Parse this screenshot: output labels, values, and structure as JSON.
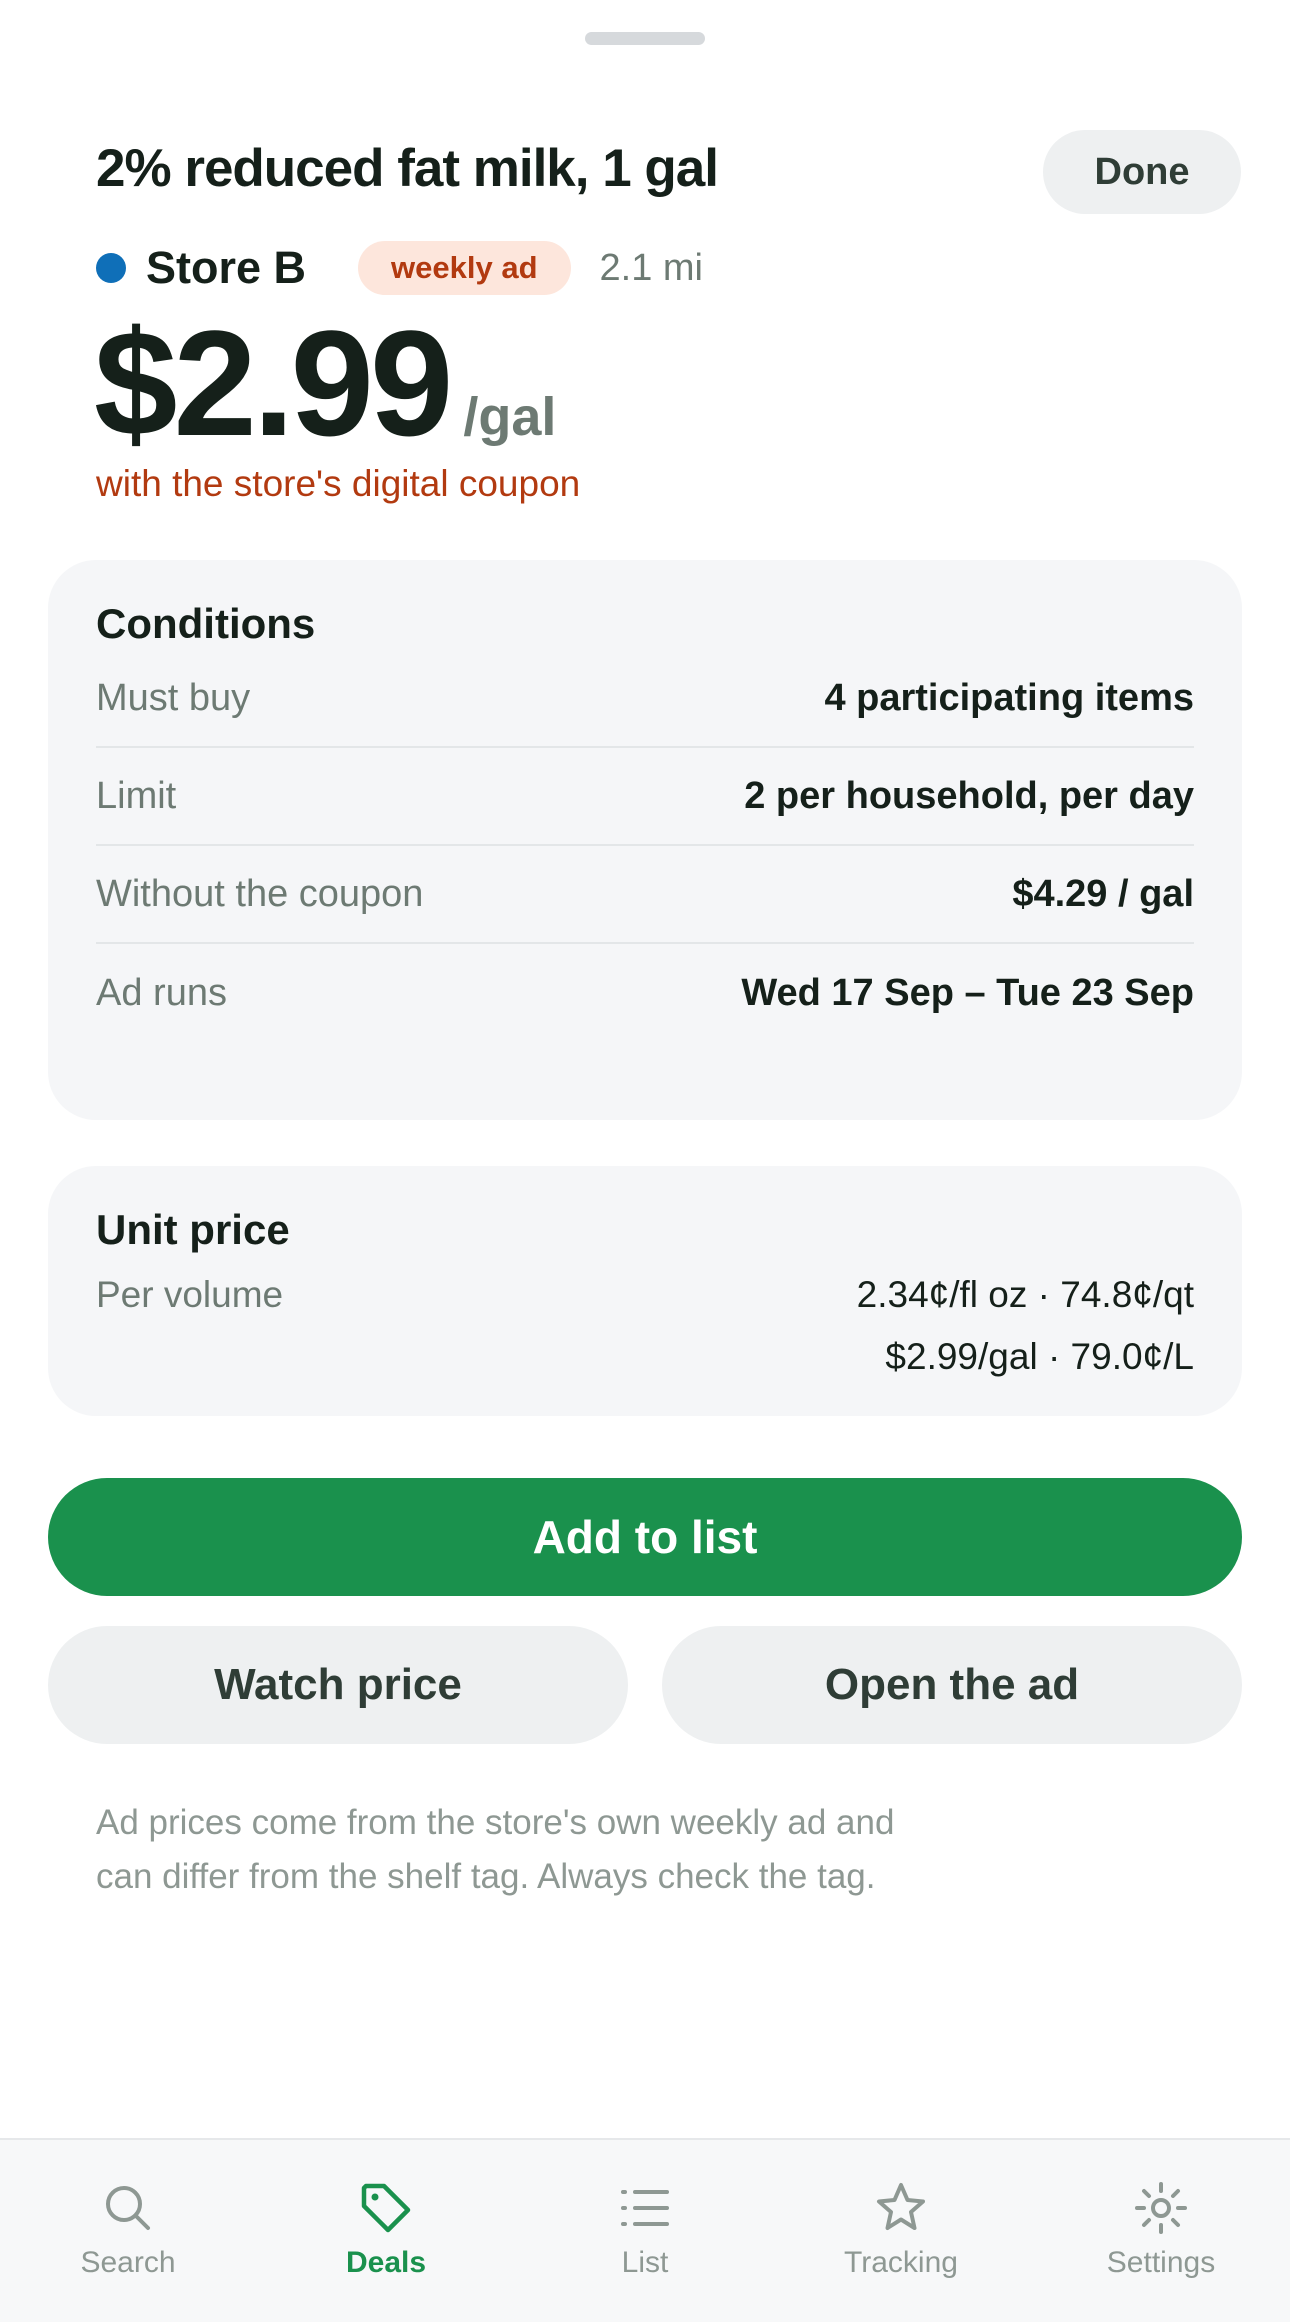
{
  "sheet": {
    "title": "2% reduced fat milk, 1 gal",
    "done_label": "Done"
  },
  "store": {
    "name": "Store B",
    "dot_color": "#0f6fb8",
    "badge": "weekly ad",
    "distance": "2.1 mi"
  },
  "price": {
    "amount": "$2.99",
    "unit": "/gal",
    "note": "with the store's digital coupon"
  },
  "conditions": {
    "title": "Conditions",
    "rows": [
      {
        "label": "Must buy",
        "value": "4 participating items"
      },
      {
        "label": "Limit",
        "value": "2 per household, per day"
      },
      {
        "label": "Without the coupon",
        "value": "$4.29 / gal"
      },
      {
        "label": "Ad runs",
        "value": "Wed 17 Sep – Tue 23 Sep"
      }
    ]
  },
  "unit_price": {
    "title": "Unit price",
    "label": "Per volume",
    "line1": "2.34¢/fl oz · 74.8¢/qt",
    "line2": "$2.99/gal · 79.0¢/L"
  },
  "actions": {
    "primary": "Add to list",
    "watch": "Watch price",
    "open_ad": "Open the ad"
  },
  "disclaimer": "Ad prices come from the store's own weekly ad and can differ from the shelf tag. Always check the tag.",
  "tabbar": {
    "active_color": "#1a914d",
    "items": [
      {
        "label": "Search",
        "icon": "search-icon"
      },
      {
        "label": "Deals",
        "icon": "tag-icon",
        "active": true
      },
      {
        "label": "List",
        "icon": "list-icon"
      },
      {
        "label": "Tracking",
        "icon": "star-icon"
      },
      {
        "label": "Settings",
        "icon": "gear-icon"
      }
    ]
  }
}
